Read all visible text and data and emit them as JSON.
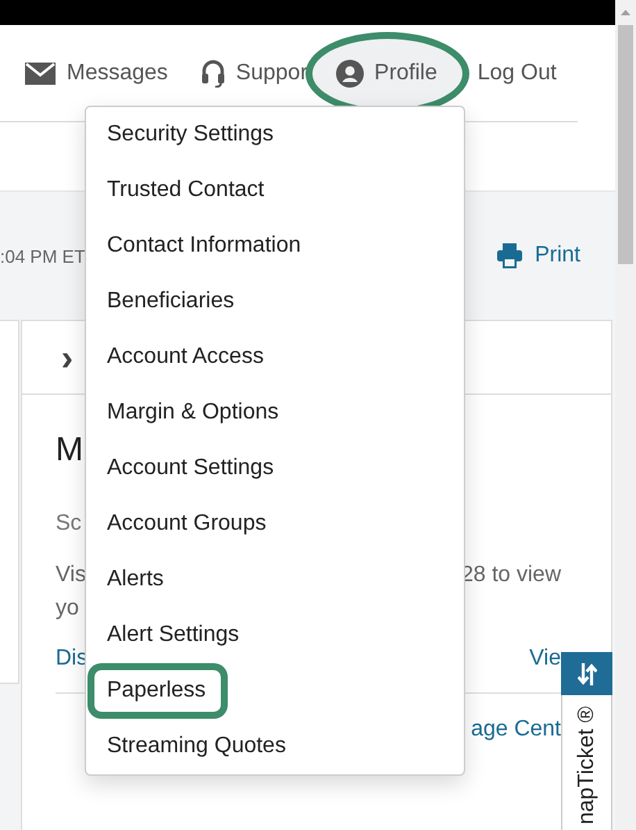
{
  "nav": [
    {
      "label": "Messages",
      "highlighted": false
    },
    {
      "label": "Suppor",
      "highlighted": false
    },
    {
      "label": "Profile",
      "highlighted": true
    },
    {
      "label": "Log Out",
      "highlighted": false
    }
  ],
  "toolbar": {
    "timestamp": ":04 PM ET",
    "print": "Print"
  },
  "card": {
    "expander": "›",
    "heading": "M",
    "subtitle": "Sc",
    "body_left": "Vis",
    "body_right": "28 to view",
    "body_line2": "yo",
    "link_left": "Dis",
    "link_right": "Vie",
    "link_center": "age Cent"
  },
  "profile_menu": [
    {
      "label": "Security Settings",
      "highlighted": false
    },
    {
      "label": "Trusted Contact",
      "highlighted": false
    },
    {
      "label": "Contact Information",
      "highlighted": false
    },
    {
      "label": "Beneficiaries",
      "highlighted": false
    },
    {
      "label": "Account Access",
      "highlighted": false
    },
    {
      "label": "Margin & Options",
      "highlighted": false
    },
    {
      "label": "Account Settings",
      "highlighted": false
    },
    {
      "label": "Account Groups",
      "highlighted": false
    },
    {
      "label": "Alerts",
      "highlighted": false
    },
    {
      "label": "Alert Settings",
      "highlighted": false
    },
    {
      "label": "Paperless",
      "highlighted": true
    },
    {
      "label": "Streaming Quotes",
      "highlighted": false
    }
  ],
  "snap_ticket": {
    "label": "napTicket ®"
  }
}
